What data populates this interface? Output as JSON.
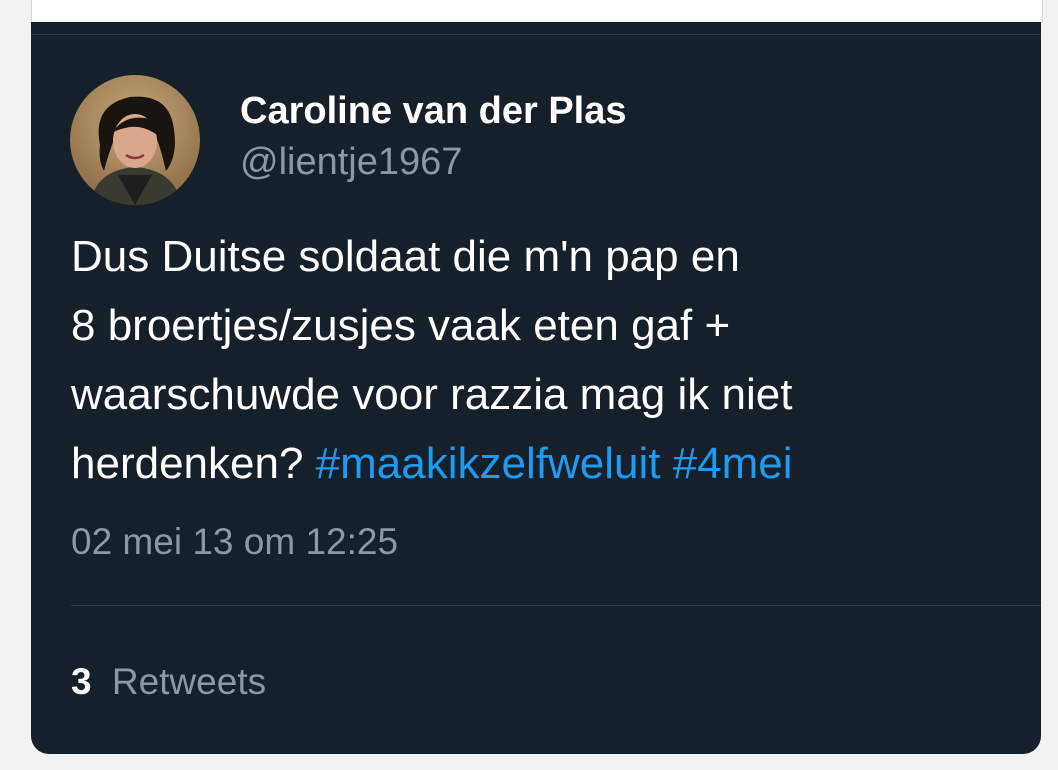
{
  "tweet": {
    "author": {
      "display_name": "Caroline van der Plas",
      "handle": "@lientje1967",
      "avatar_icon": "profile-photo"
    },
    "text_lines": [
      [
        {
          "text": "Dus Duitse soldaat die m'n pap en",
          "type": "text"
        }
      ],
      [
        {
          "text": "8 broertjes/zusjes vaak eten gaf +",
          "type": "text"
        }
      ],
      [
        {
          "text": "waarschuwde voor razzia mag ik niet",
          "type": "text"
        }
      ],
      [
        {
          "text": "herdenken? ",
          "type": "text"
        },
        {
          "text": "#maakikzelfweluit",
          "type": "hashtag"
        },
        {
          "text": " ",
          "type": "text"
        },
        {
          "text": "#4mei",
          "type": "hashtag"
        }
      ]
    ],
    "timestamp": "02 mei 13 om 12:25",
    "stats": {
      "retweet_count": "3",
      "retweet_label": "Retweets"
    }
  },
  "colors": {
    "background": "#15202b",
    "text": "#ffffff",
    "secondary": "#8b98a5",
    "link": "#1d9bf0"
  }
}
